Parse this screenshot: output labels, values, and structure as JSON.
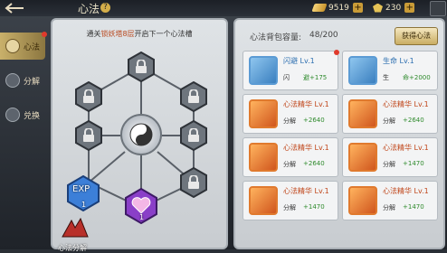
{
  "header": {
    "title": "心法",
    "help_icon": "?",
    "currency_gold": "9519",
    "currency_gem": "230",
    "plus_symbol": "+"
  },
  "sidebar": {
    "items": [
      {
        "label": "心法"
      },
      {
        "label": "分解"
      },
      {
        "label": "兑换"
      }
    ]
  },
  "left_panel": {
    "hint_prefix": "通关",
    "hint_highlight": "锁妖塔8层",
    "hint_suffix": "开启下一个心法槽",
    "node_labels": {
      "exp": "EXP",
      "exp_level": "1",
      "heart_level": "1"
    },
    "bottom_label": "心法分解"
  },
  "right_panel": {
    "capacity_label": "心法背包容量:",
    "capacity_value": "48/200",
    "get_button": "获得心法",
    "cards": [
      {
        "name": "闪避 Lv.1",
        "stat": "闪",
        "value": "避+175",
        "color": "blue",
        "dot": true
      },
      {
        "name": "生命 Lv.1",
        "stat": "生",
        "value": "命+2000",
        "color": "blue",
        "dot": false
      },
      {
        "name": "心法精华 Lv.1",
        "stat": "分解",
        "value": "+2640",
        "color": "orange",
        "dot": false
      },
      {
        "name": "心法精华 Lv.1",
        "stat": "分解",
        "value": "+2640",
        "color": "orange",
        "dot": false
      },
      {
        "name": "心法精华 Lv.1",
        "stat": "分解",
        "value": "+2640",
        "color": "orange",
        "dot": false
      },
      {
        "name": "心法精华 Lv.1",
        "stat": "分解",
        "value": "+1470",
        "color": "orange",
        "dot": false
      },
      {
        "name": "心法精华 Lv.1",
        "stat": "分解",
        "value": "+1470",
        "color": "orange",
        "dot": false
      },
      {
        "name": "心法精华 Lv.1",
        "stat": "分解",
        "value": "+1470",
        "color": "orange",
        "dot": false
      }
    ]
  },
  "colors": {
    "accent": "#c9b06a",
    "blue": "#2d6fb0",
    "orange": "#c0461a",
    "green": "#2e8a2c"
  }
}
